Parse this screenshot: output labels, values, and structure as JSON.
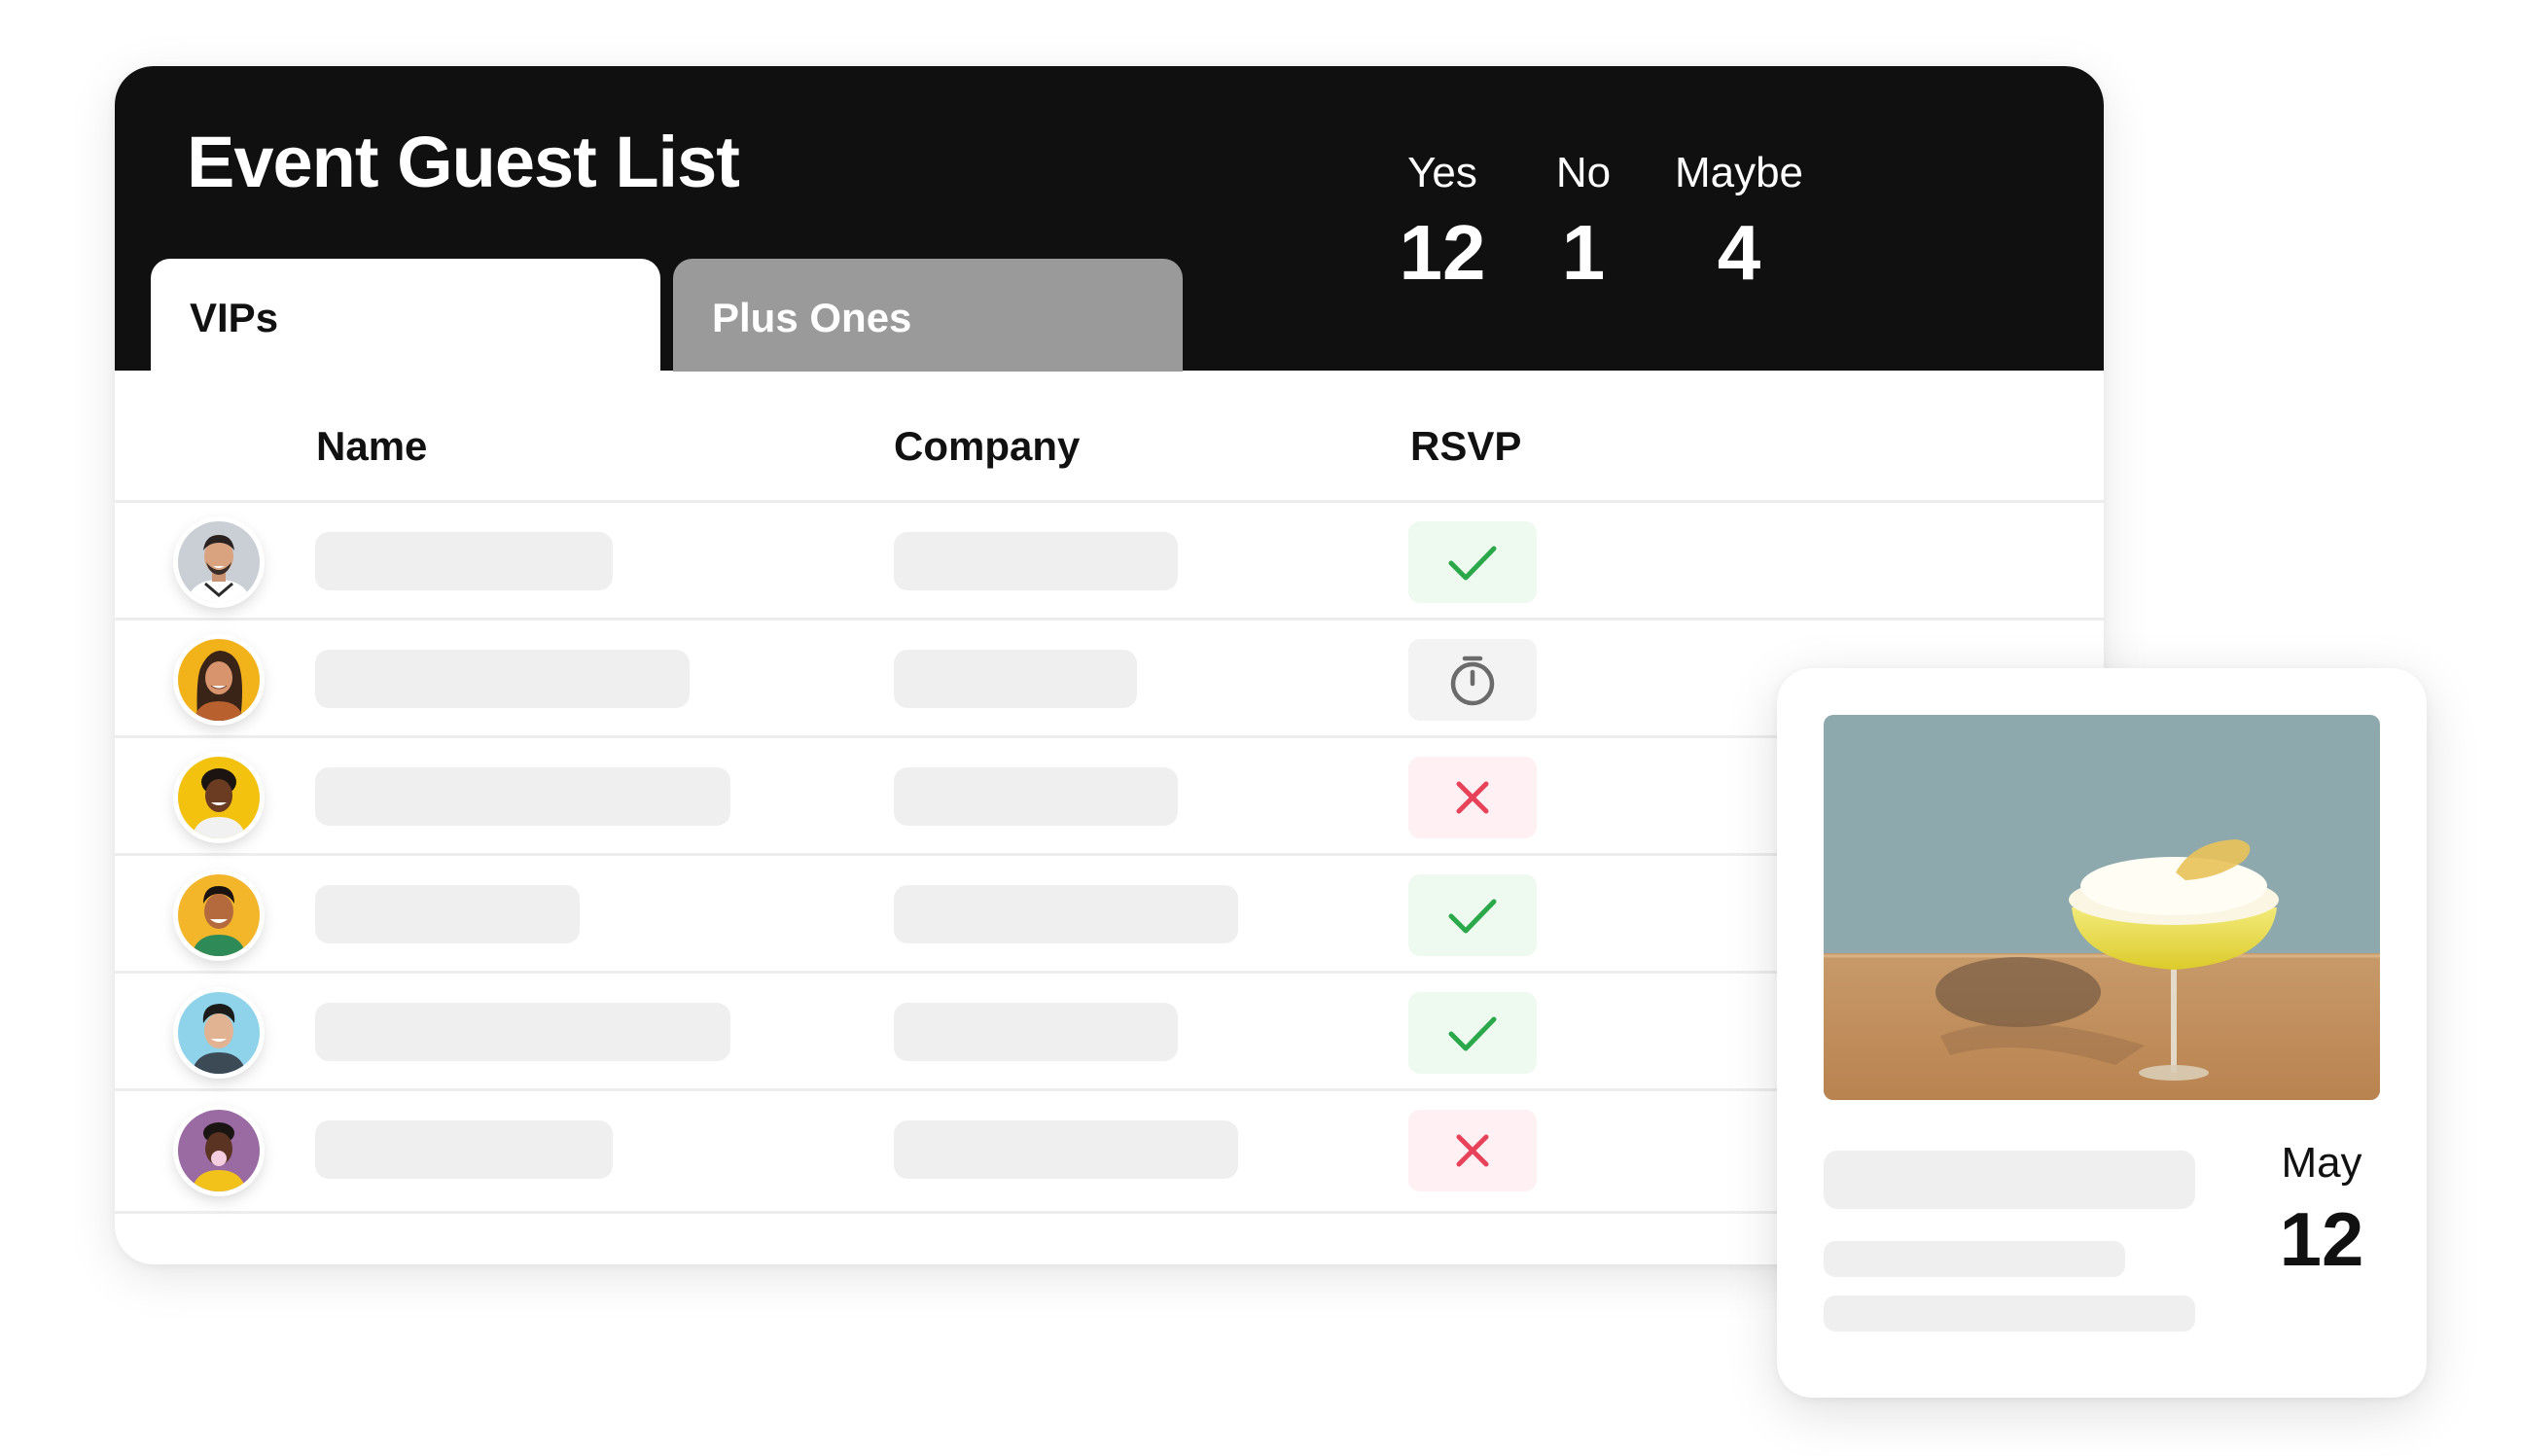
{
  "header": {
    "title": "Event Guest List",
    "stats": [
      {
        "label": "Yes",
        "value": "12"
      },
      {
        "label": "No",
        "value": "1"
      },
      {
        "label": "Maybe",
        "value": "4"
      }
    ]
  },
  "tabs": [
    {
      "label": "VIPs",
      "active": true
    },
    {
      "label": "Plus Ones",
      "active": false
    }
  ],
  "table": {
    "columns": [
      "Name",
      "Company",
      "RSVP"
    ],
    "rows": [
      {
        "rsvp": "yes",
        "icon": "check-icon"
      },
      {
        "rsvp": "maybe",
        "icon": "stopwatch-icon"
      },
      {
        "rsvp": "no",
        "icon": "x-icon"
      },
      {
        "rsvp": "yes",
        "icon": "check-icon"
      },
      {
        "rsvp": "yes",
        "icon": "check-icon"
      },
      {
        "rsvp": "no",
        "icon": "x-icon"
      }
    ]
  },
  "event": {
    "month": "May",
    "day": "12"
  },
  "colors": {
    "header_bg": "#101010",
    "inactive_tab": "#9a9a9a",
    "placeholder": "#efefef",
    "yes": "#2aa84a",
    "yes_bg": "#eef9f0",
    "maybe": "#6b6b6b",
    "maybe_bg": "#f3f3f3",
    "no": "#e8425a",
    "no_bg": "#fff0f3"
  }
}
